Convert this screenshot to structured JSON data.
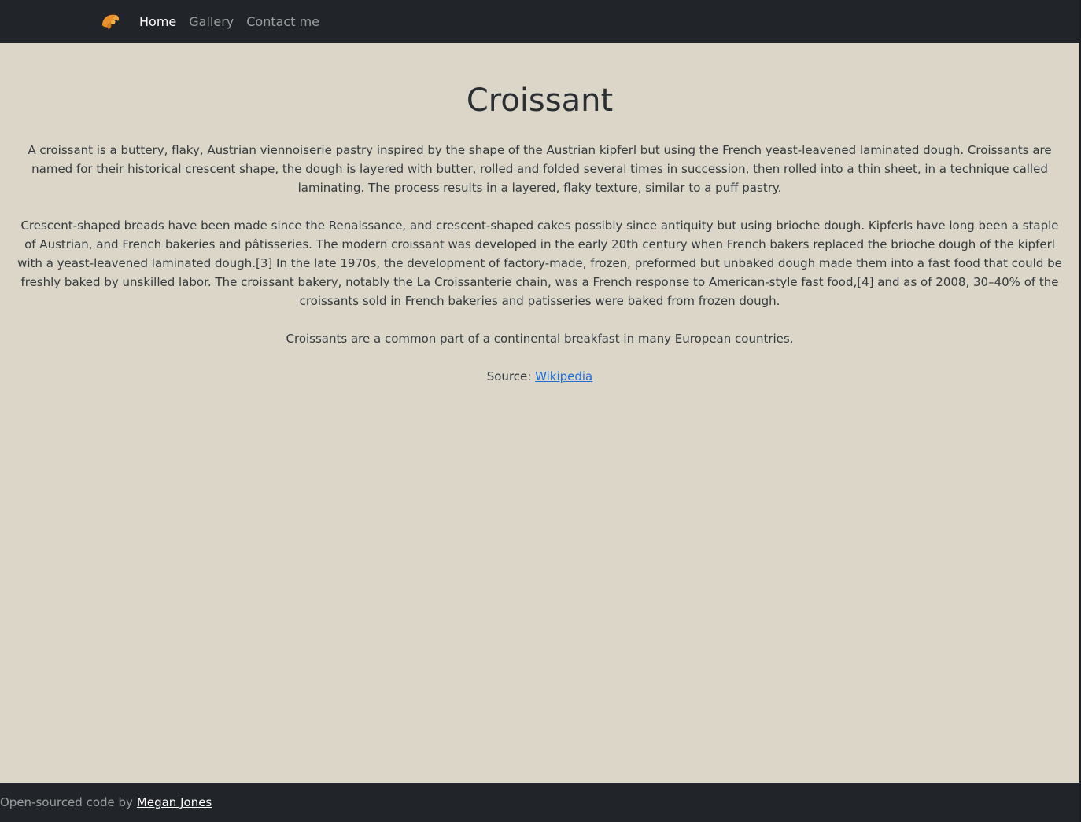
{
  "nav": {
    "brand_icon": "croissant-icon",
    "items": [
      {
        "label": "Home",
        "active": true
      },
      {
        "label": "Gallery",
        "active": false
      },
      {
        "label": "Contact me",
        "active": false
      }
    ]
  },
  "main": {
    "title": "Croissant",
    "paragraphs": [
      "A croissant is a buttery, flaky, Austrian viennoiserie pastry inspired by the shape of the Austrian kipferl but using the French yeast-leavened laminated dough. Croissants are named for their historical crescent shape, the dough is layered with butter, rolled and folded several times in succession, then rolled into a thin sheet, in a technique called laminating. The process results in a layered, flaky texture, similar to a puff pastry.",
      "Crescent-shaped breads have been made since the Renaissance, and crescent-shaped cakes possibly since antiquity but using brioche dough. Kipferls have long been a staple of Austrian, and French bakeries and pâtisseries. The modern croissant was developed in the early 20th century when French bakers replaced the brioche dough of the kipferl with a yeast-leavened laminated dough.[3] In the late 1970s, the development of factory-made, frozen, preformed but unbaked dough made them into a fast food that could be freshly baked by unskilled labor. The croissant bakery, notably the La Croissanterie chain, was a French response to American-style fast food,[4] and as of 2008, 30–40% of the croissants sold in French bakeries and patisseries were baked from frozen dough.",
      "Croissants are a common part of a continental breakfast in many European countries."
    ],
    "source_label": "Source:",
    "source_link": "Wikipedia"
  },
  "footer": {
    "text": "Open-sourced code by",
    "author": "Megan Jones"
  },
  "colors": {
    "navbar_bg": "#212529",
    "page_bg": "#dcd6c8",
    "link": "#1f6fd6",
    "brand_icon": "#e8902a"
  }
}
